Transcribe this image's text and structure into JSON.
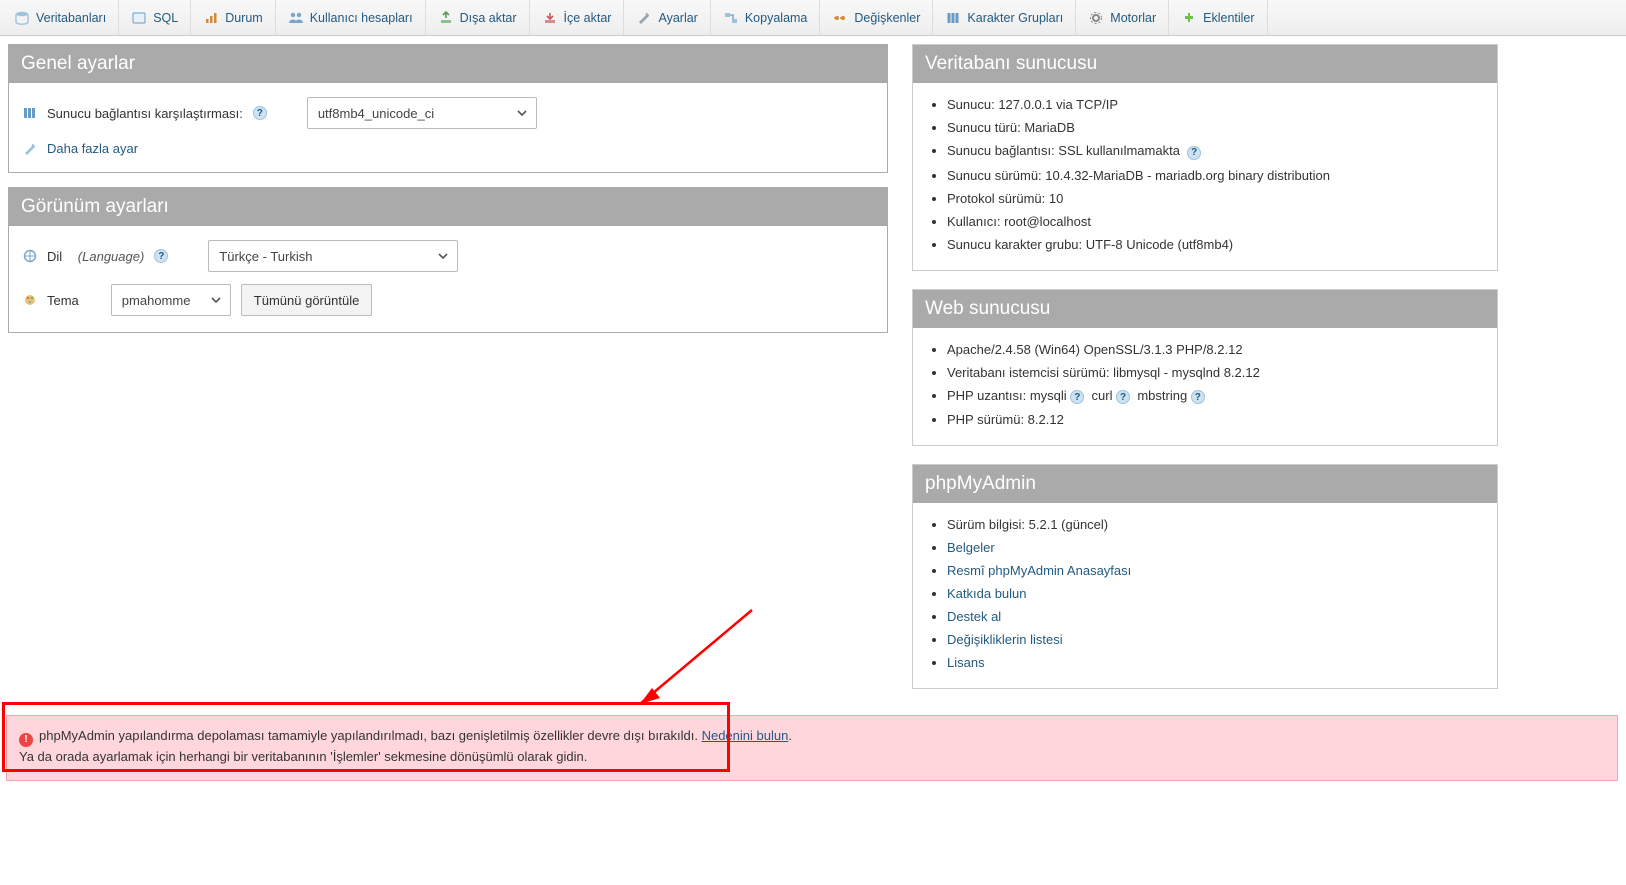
{
  "tabs": [
    {
      "label": "Veritabanları",
      "icon": "db"
    },
    {
      "label": "SQL",
      "icon": "sql"
    },
    {
      "label": "Durum",
      "icon": "status"
    },
    {
      "label": "Kullanıcı hesapları",
      "icon": "users"
    },
    {
      "label": "Dışa aktar",
      "icon": "export"
    },
    {
      "label": "İçe aktar",
      "icon": "import"
    },
    {
      "label": "Ayarlar",
      "icon": "settings"
    },
    {
      "label": "Kopyalama",
      "icon": "replication"
    },
    {
      "label": "Değişkenler",
      "icon": "variables"
    },
    {
      "label": "Karakter Grupları",
      "icon": "charsets"
    },
    {
      "label": "Motorlar",
      "icon": "engines"
    },
    {
      "label": "Eklentiler",
      "icon": "plugins"
    }
  ],
  "general": {
    "title": "Genel ayarlar",
    "collation_label": "Sunucu bağlantısı karşılaştırması:",
    "collation_value": "utf8mb4_unicode_ci",
    "more_label": "Daha fazla ayar"
  },
  "appearance": {
    "title": "Görünüm ayarları",
    "lang_label": "Dil",
    "lang_paren": "(Language)",
    "lang_value": "Türkçe - Turkish",
    "theme_label": "Tema",
    "theme_value": "pmahomme",
    "view_all": "Tümünü görüntüle"
  },
  "db_server": {
    "title": "Veritabanı sunucusu",
    "items": [
      "Sunucu: 127.0.0.1 via TCP/IP",
      "Sunucu türü: MariaDB",
      "Sunucu bağlantısı: SSL kullanılmamakta",
      "Sunucu sürümü: 10.4.32-MariaDB - mariadb.org binary distribution",
      "Protokol sürümü: 10",
      "Kullanıcı: root@localhost",
      "Sunucu karakter grubu: UTF-8 Unicode (utf8mb4)"
    ]
  },
  "web_server": {
    "title": "Web sunucusu",
    "items": [
      "Apache/2.4.58 (Win64) OpenSSL/3.1.3 PHP/8.2.12",
      "Veritabanı istemcisi sürümü: libmysql - mysqlnd 8.2.12",
      "PHP uzantısı: mysqli   curl   mbstring",
      "PHP sürümü: 8.2.12"
    ]
  },
  "pma": {
    "title": "phpMyAdmin",
    "version": "Sürüm bilgisi: 5.2.1 (güncel)",
    "links": [
      "Belgeler",
      "Resmî phpMyAdmin Anasayfası",
      "Katkıda bulun",
      "Destek al",
      "Değişikliklerin listesi",
      "Lisans"
    ]
  },
  "alert": {
    "text1": "phpMyAdmin yapılandırma depolaması tamamiyle yapılandırılmadı, bazı genişletilmiş özellikler devre dışı bırakıldı. ",
    "link": "Nedenini bulun",
    "text2": ".",
    "text3": "Ya da orada ayarlamak için herhangi bir veritabanının 'İşlemler' sekmesine dönüşümlü olarak gidin."
  }
}
